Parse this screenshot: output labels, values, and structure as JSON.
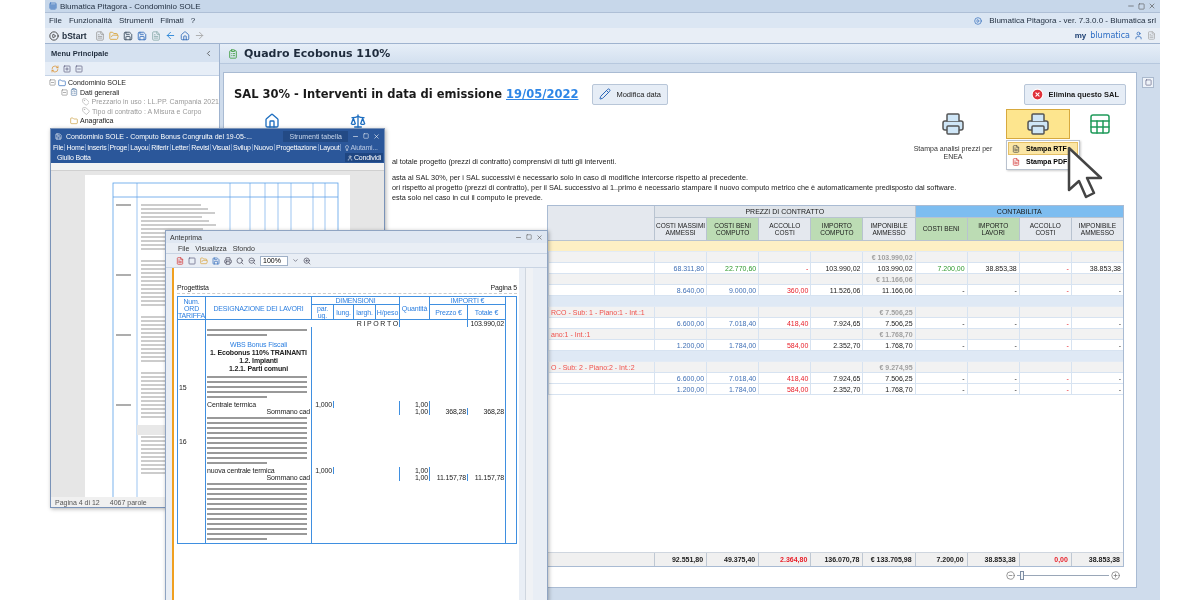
{
  "app": {
    "title": "Blumatica Pitagora - Condominio SOLE",
    "menu": [
      "File",
      "Funzionalità",
      "Strumenti",
      "Filmati",
      "?"
    ],
    "version": "Blumatica Pitagora - ver. 7.3.0.0 - Blumatica srl",
    "start": "bStart",
    "brand_prefix": "my",
    "brand": "blumatica"
  },
  "sidebar": {
    "title": "Menu Principale",
    "tree": [
      {
        "label": "Condominio SOLE",
        "kind": "root",
        "expanded": true,
        "children": [
          {
            "label": "Dati generali",
            "kind": "sheet",
            "expanded": true,
            "children": [
              {
                "label": "Prezzario in uso : LL.PP. Campania 2021",
                "kind": "property"
              },
              {
                "label": "Tipo di contratto : A Misura e Corpo",
                "kind": "property"
              }
            ]
          },
          {
            "label": "Anagrafica",
            "kind": "folder"
          }
        ]
      }
    ]
  },
  "panel": {
    "title": "Quadro Ecobonus 110%",
    "heading": "SAL 30% - Interventi in data di emissione",
    "date": "19/05/2022",
    "edit_button": "Modifica data",
    "delete_button": "Elimina questo SAL",
    "enea_label": "Stampa analisi prezzi per ENEA",
    "print_menu": [
      {
        "label": "Stampa RTF",
        "kind": "rtf",
        "selected": true
      },
      {
        "label": "Stampa PDF",
        "kind": "pdf",
        "selected": false
      }
    ],
    "zoom": {
      "level": 0.03
    },
    "notes": [
      "al totale progetto (prezzi di contratto) comprensivi di tutti gli interventi.",
      "asta al SAL 30%, per i SAL successivi è necessario solo in caso di modifiche intercorse rispetto al precedente.",
      "ori rispetto al progetto (prezzi di contratto), per il SAL successivo al 1..primo è necessario stampare il nuovo computo metrico che è automaticamente predisposto dal software.",
      "esta solo nel caso in cui il computo le prevede."
    ]
  },
  "table": {
    "groups": [
      {
        "label": "PREZZI DI CONTRATTO",
        "selected": false,
        "columns": [
          {
            "label": "COSTI MASSIMI AMMESSI",
            "highlighted": false
          },
          {
            "label": "COSTI BENI COMPUTO",
            "highlighted": true
          },
          {
            "label": "ACCOLLO COSTI",
            "highlighted": false
          },
          {
            "label": "IMPORTO COMPUTO",
            "highlighted": true
          },
          {
            "label": "IMPONIBILE AMMESSO",
            "highlighted": false
          }
        ]
      },
      {
        "label": "CONTABILITA",
        "selected": true,
        "columns": [
          {
            "label": "COSTI BENI",
            "highlighted": true
          },
          {
            "label": "IMPORTO LAVORI",
            "highlighted": true
          },
          {
            "label": "ACCOLLO COSTI",
            "highlighted": false
          },
          {
            "label": "IMPONIBILE AMMESSO",
            "highlighted": false
          }
        ]
      }
    ],
    "rows": [
      {
        "kind": "band",
        "color": "#fdefc4"
      },
      {
        "kind": "subtotal",
        "total": "€ 103.990,02"
      },
      {
        "kind": "values",
        "cells": [
          {
            "text": "68.311,80",
            "kind": "estimate"
          },
          {
            "text": "22.770,60",
            "kind": "goods"
          },
          {
            "text": "-",
            "kind": "deduction"
          },
          {
            "text": "103.990,02",
            "kind": "amount"
          },
          {
            "text": "103.990,02",
            "kind": "amount"
          },
          {
            "text": "7.200,00",
            "kind": "goods"
          },
          {
            "text": "38.853,38",
            "kind": "amount"
          },
          {
            "text": "-",
            "kind": "deduction"
          },
          {
            "text": "38.853,38",
            "kind": "amount"
          }
        ]
      },
      {
        "kind": "subtotal",
        "total": "€ 11.166,06"
      },
      {
        "kind": "values",
        "cells": [
          {
            "text": "8.640,00",
            "kind": "estimate"
          },
          {
            "text": "9.000,00",
            "kind": "estimate"
          },
          {
            "text": "360,00",
            "kind": "deduction"
          },
          {
            "text": "11.526,06",
            "kind": "amount"
          },
          {
            "text": "11.166,06",
            "kind": "amount"
          },
          {
            "text": "-",
            "kind": "amount"
          },
          {
            "text": "-",
            "kind": "amount"
          },
          {
            "text": "-",
            "kind": "deduction"
          },
          {
            "text": "-",
            "kind": "amount"
          }
        ]
      },
      {
        "kind": "band",
        "color": "#dfe9f5"
      },
      {
        "kind": "subtotal",
        "label": "RCO - Sub: 1 - Piano:1 - Int.:1",
        "total": "€ 7.506,25"
      },
      {
        "kind": "values",
        "cells": [
          {
            "text": "6.600,00",
            "kind": "estimate"
          },
          {
            "text": "7.018,40",
            "kind": "estimate"
          },
          {
            "text": "418,40",
            "kind": "deduction"
          },
          {
            "text": "7.924,65",
            "kind": "amount"
          },
          {
            "text": "7.506,25",
            "kind": "amount"
          },
          {
            "text": "-",
            "kind": "amount"
          },
          {
            "text": "-",
            "kind": "amount"
          },
          {
            "text": "-",
            "kind": "deduction"
          },
          {
            "text": "-",
            "kind": "amount"
          }
        ]
      },
      {
        "kind": "subtotal",
        "label": "ano:1 - Int.:1",
        "total": "€ 1.768,70"
      },
      {
        "kind": "values",
        "cells": [
          {
            "text": "1.200,00",
            "kind": "estimate"
          },
          {
            "text": "1.784,00",
            "kind": "estimate"
          },
          {
            "text": "584,00",
            "kind": "deduction"
          },
          {
            "text": "2.352,70",
            "kind": "amount"
          },
          {
            "text": "1.768,70",
            "kind": "amount"
          },
          {
            "text": "-",
            "kind": "amount"
          },
          {
            "text": "-",
            "kind": "amount"
          },
          {
            "text": "-",
            "kind": "deduction"
          },
          {
            "text": "-",
            "kind": "amount"
          }
        ]
      },
      {
        "kind": "band",
        "color": "#dfe9f5"
      },
      {
        "kind": "subtotal",
        "label": "O - Sub: 2 - Piano:2 - Int.:2",
        "total": "€ 9.274,95"
      },
      {
        "kind": "values",
        "cells": [
          {
            "text": "6.600,00",
            "kind": "estimate"
          },
          {
            "text": "7.018,40",
            "kind": "estimate"
          },
          {
            "text": "418,40",
            "kind": "deduction"
          },
          {
            "text": "7.924,65",
            "kind": "amount"
          },
          {
            "text": "7.506,25",
            "kind": "amount"
          },
          {
            "text": "-",
            "kind": "amount"
          },
          {
            "text": "-",
            "kind": "amount"
          },
          {
            "text": "-",
            "kind": "deduction"
          },
          {
            "text": "-",
            "kind": "amount"
          }
        ]
      },
      {
        "kind": "values",
        "cells": [
          {
            "text": "1.200,00",
            "kind": "estimate"
          },
          {
            "text": "1.784,00",
            "kind": "estimate"
          },
          {
            "text": "584,00",
            "kind": "deduction"
          },
          {
            "text": "2.352,70",
            "kind": "amount"
          },
          {
            "text": "1.768,70",
            "kind": "amount"
          },
          {
            "text": "-",
            "kind": "amount"
          },
          {
            "text": "-",
            "kind": "amount"
          },
          {
            "text": "-",
            "kind": "deduction"
          },
          {
            "text": "-",
            "kind": "amount"
          }
        ]
      }
    ],
    "totals": [
      {
        "text": "92.551,80",
        "kind": "amount"
      },
      {
        "text": "49.375,40",
        "kind": "amount"
      },
      {
        "text": "2.364,80",
        "kind": "deduction"
      },
      {
        "text": "136.070,78",
        "kind": "amount"
      },
      {
        "text": "€ 133.705,98",
        "kind": "amount"
      },
      {
        "text": "7.200,00",
        "kind": "amount"
      },
      {
        "text": "38.853,38",
        "kind": "amount"
      },
      {
        "text": "0,00",
        "kind": "deduction"
      },
      {
        "text": "38.853,38",
        "kind": "amount"
      }
    ]
  },
  "word_window": {
    "title": "Condominio SOLE - Computo Bonus Congruita del 19-05-...",
    "context_tab": "Strumenti tabella",
    "tabs": [
      "File",
      "Home",
      "Inseris",
      "Proge",
      "Layou",
      "Riferir",
      "Letter",
      "Revisi",
      "Visual",
      "Svilup",
      "Nuovo",
      "Progettazione",
      "Layout"
    ],
    "help": "Aiutami...",
    "user": "Giulio Botta",
    "share": "Condividi",
    "status": [
      "Pagina 4 di 12",
      "4067 parole"
    ]
  },
  "preview_window": {
    "title": "Anteprima",
    "menu": [
      "File",
      "Visualizza",
      "Sfondo"
    ],
    "zoom": "100%",
    "page": {
      "left_header": "Progettista",
      "right_header": "Pagina 5",
      "head": {
        "code": "Num. ORD TARIFFA",
        "description": "DESIGNAZIONE DEI LAVORI",
        "dimensions": "DIMENSIONI",
        "dim_columns": [
          "par. ug.",
          "lung.",
          "largh.",
          "H/peso"
        ],
        "quantity": "Quantità",
        "amounts": "IMPORTI €",
        "amount_columns": [
          "Prezzo €",
          "Totale €"
        ]
      },
      "carry_label": "R I P O R T O",
      "carry_value": "103.990,02",
      "headings": [
        "WBS Bonus Fiscali",
        "1. Ecobonus 110% TRAINANTI",
        "1.2. Impianti",
        "1.2.1. Parti comuni"
      ],
      "items": [
        {
          "code": "15",
          "label": "Centrale termica",
          "factor": "1,000",
          "quantity": "1,00",
          "sum_label": "Sommano cad",
          "sum_quantity": "1,00",
          "price": "368,28",
          "total": "368,28"
        },
        {
          "code": "16",
          "label": "nuova centrale termica",
          "factor": "1,000",
          "quantity": "1,00",
          "sum_label": "Sommano cad",
          "sum_quantity": "1,00",
          "price": "11.157,78",
          "total": "11.157,78"
        }
      ]
    }
  }
}
